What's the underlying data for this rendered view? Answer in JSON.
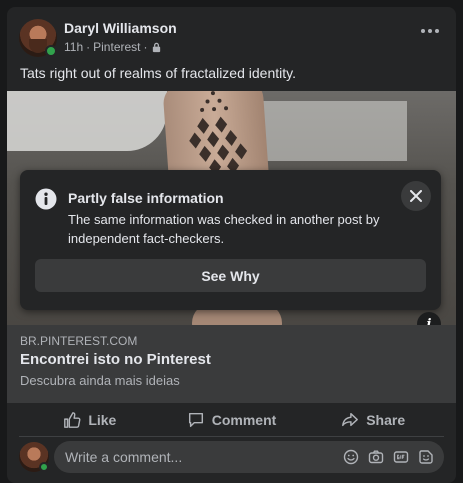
{
  "post": {
    "author": "Daryl Williamson",
    "time": "11h",
    "source": "Pinterest",
    "separator": "·",
    "caption": "Tats right out of realms of fractalized identity."
  },
  "fact_check": {
    "title": "Partly false information",
    "text": "The same information was checked in another post by independent fact-checkers.",
    "button": "See Why"
  },
  "link_preview": {
    "domain": "BR.PINTEREST.COM",
    "title": "Encontrei isto no Pinterest",
    "subtitle": "Descubra ainda mais ideias"
  },
  "actions": {
    "like": "Like",
    "comment": "Comment",
    "share": "Share"
  },
  "comment_box": {
    "placeholder": "Write a comment..."
  },
  "colors": {
    "background": "#18191a",
    "card": "#242526",
    "surface": "#3a3b3c",
    "text": "#e4e6eb",
    "secondary": "#b0b3b8",
    "online": "#31a24c"
  }
}
